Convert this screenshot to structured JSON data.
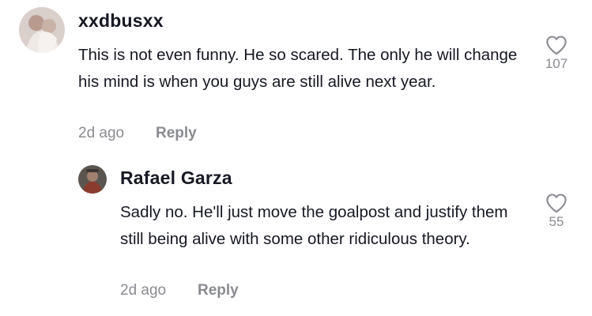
{
  "comments": [
    {
      "username": "xxdbusxx",
      "text": "This is not even funny. He so scared. The only he will change his mind is when you guys are still alive next year.",
      "time": "2d ago",
      "reply_label": "Reply",
      "likes": "107",
      "avatar_icon": "user-avatar-photo",
      "like_icon": "heart-outline-icon"
    },
    {
      "username": "Rafael Garza",
      "text": "Sadly no. He'll just move the goalpost and justify them still being alive with some other ridiculous theory.",
      "time": "2d ago",
      "reply_label": "Reply",
      "likes": "55",
      "avatar_icon": "user-avatar-photo",
      "like_icon": "heart-outline-icon"
    }
  ]
}
